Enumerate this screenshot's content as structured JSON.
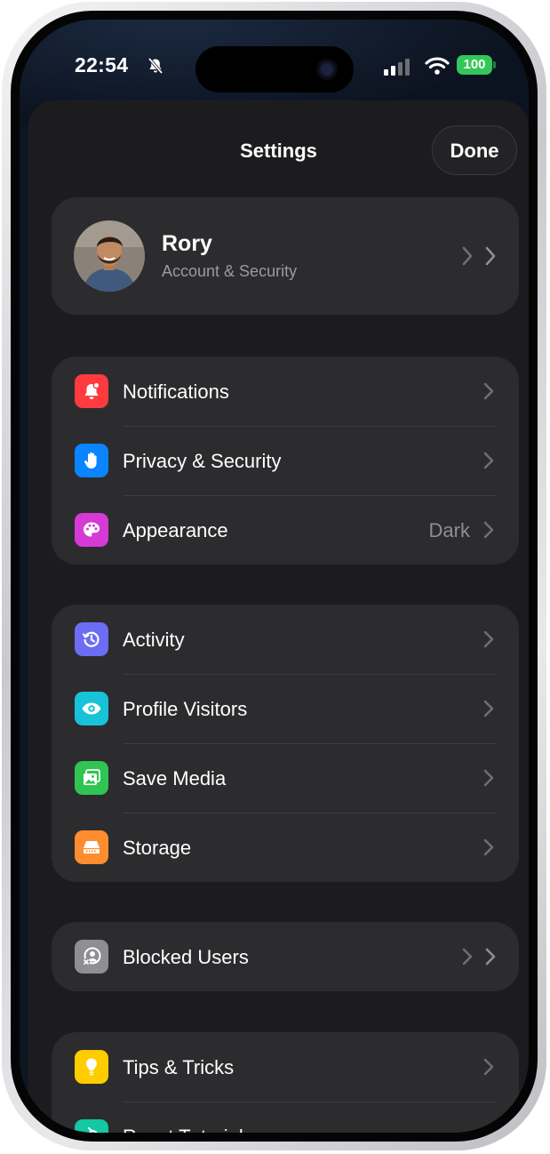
{
  "status_bar": {
    "time": "22:54",
    "battery": "100"
  },
  "header": {
    "title": "Settings",
    "done_label": "Done"
  },
  "profile": {
    "name": "Rory",
    "subtitle": "Account & Security"
  },
  "groups": [
    [
      {
        "label": "Notifications",
        "icon": "bell-badge-icon",
        "color": "#ff3b3f"
      },
      {
        "label": "Privacy & Security",
        "icon": "hand-icon",
        "color": "#0a84ff"
      },
      {
        "label": "Appearance",
        "value": "Dark",
        "icon": "palette-icon",
        "color": "#d63ad6"
      }
    ],
    [
      {
        "label": "Activity",
        "icon": "history-icon",
        "color": "#6c6cf5"
      },
      {
        "label": "Profile Visitors",
        "icon": "eye-icon",
        "color": "#18c3d9"
      },
      {
        "label": "Save Media",
        "icon": "photos-icon",
        "color": "#30c453"
      },
      {
        "label": "Storage",
        "icon": "storage-icon",
        "color": "#ff8c2e"
      }
    ],
    [
      {
        "label": "Blocked Users",
        "icon": "blocked-user-icon",
        "color": "#8e8e93"
      }
    ],
    [
      {
        "label": "Tips & Tricks",
        "icon": "lightbulb-icon",
        "color": "#ffcc00"
      },
      {
        "label": "Reset Tutorials",
        "icon": "reset-icon",
        "color": "#14c8a4"
      }
    ]
  ]
}
